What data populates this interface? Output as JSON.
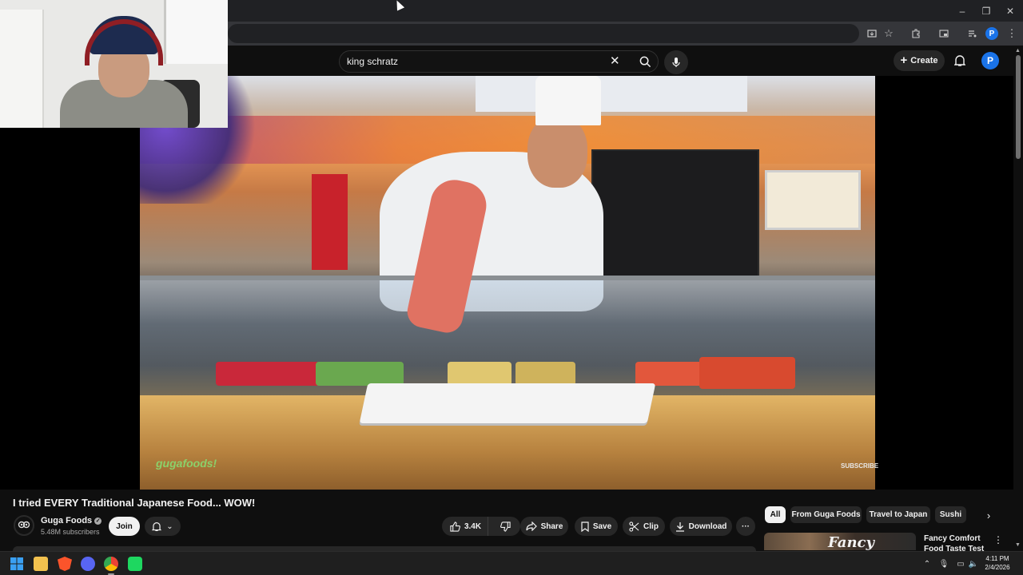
{
  "browser": {
    "window_controls": {
      "minimize": "–",
      "maximize": "❐",
      "close": "✕"
    },
    "profile_initial": "P"
  },
  "header": {
    "search": {
      "value": "king schratz",
      "clear": "✕"
    },
    "create_label": "Create",
    "avatar_initial": "P"
  },
  "video": {
    "watermark_brand": "gugafoods!",
    "watermark_subscribe": "SUBSCRIBE"
  },
  "watch": {
    "title": "I tried EVERY Traditional Japanese Food... WOW!",
    "channel": {
      "name": "Guga Foods",
      "subscribers": "5.48M subscribers",
      "join_label": "Join"
    },
    "actions": {
      "likes": "3.4K",
      "share": "Share",
      "save": "Save",
      "clip": "Clip",
      "download": "Download",
      "more": "···"
    }
  },
  "sidebar": {
    "chips": [
      "All",
      "From Guga Foods",
      "Travel to Japan",
      "Sushi"
    ],
    "next": "›",
    "recommendation": {
      "thumb_text": "Fancy",
      "title": "Fancy Comfort Food Taste Test"
    }
  },
  "taskbar": {
    "time": "4:11 PM",
    "date": "2/4/2026"
  },
  "colors": {
    "background": "#0f0f0f",
    "accent_avatar": "#1a73e8",
    "pill": "#272727"
  }
}
